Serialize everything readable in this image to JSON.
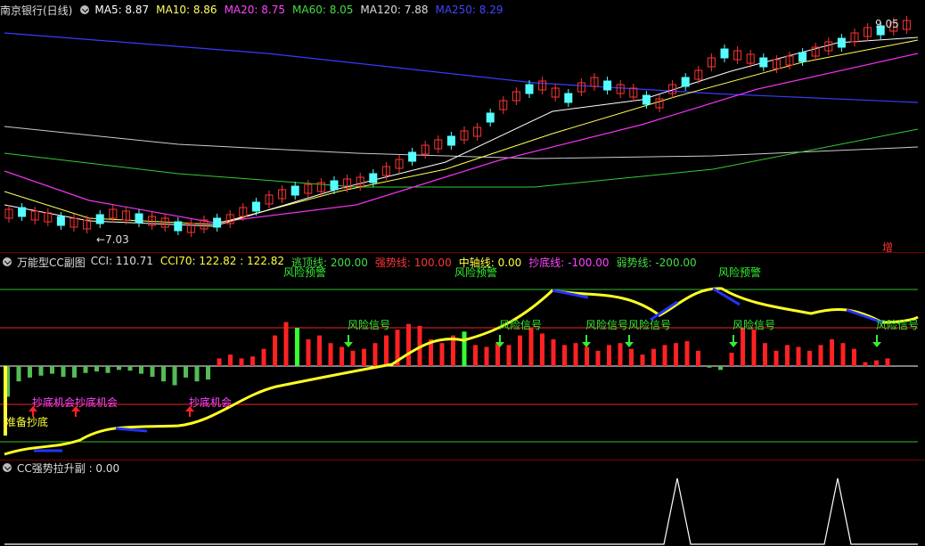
{
  "main": {
    "stock_title": "南京银行(日线)",
    "ma": [
      {
        "label": "MA5: 8.87",
        "color": "#ffffff"
      },
      {
        "label": "MA10: 8.86",
        "color": "#ffff66"
      },
      {
        "label": "MA20: 8.75",
        "color": "#ff44ff"
      },
      {
        "label": "MA60: 8.05",
        "color": "#44dd44"
      },
      {
        "label": "MA120: 7.88",
        "color": "#dddddd"
      },
      {
        "label": "MA250: 8.29",
        "color": "#4444ff"
      }
    ],
    "high_label": "9.05",
    "low_label": "←7.03",
    "corner_badge": "增"
  },
  "cci_panel": {
    "title": "万能型CC副图",
    "values": [
      {
        "label": "CCI: 110.71",
        "color": "#dddddd"
      },
      {
        "label": "CCI70: 122.82 : 122.82",
        "color": "#ffff44"
      },
      {
        "label": "逃顶线: 200.00",
        "color": "#44dd44"
      },
      {
        "label": "强势线: 100.00",
        "color": "#ff3333"
      },
      {
        "label": "中轴线: 0.00",
        "color": "#ffff44"
      },
      {
        "label": "抄底线: -100.00",
        "color": "#ff44ff"
      },
      {
        "label": "弱势线: -200.00",
        "color": "#44dd44"
      }
    ],
    "signals": {
      "risk": "风险信号",
      "buy": "抄底机会",
      "prepare": "准备抄底",
      "warn": "风险预警"
    }
  },
  "bottom_panel": {
    "title": "CC强势拉升副 : 0.00"
  },
  "colors": {
    "up": "#ff3333",
    "down": "#55ffff",
    "bg": "#000000"
  }
}
